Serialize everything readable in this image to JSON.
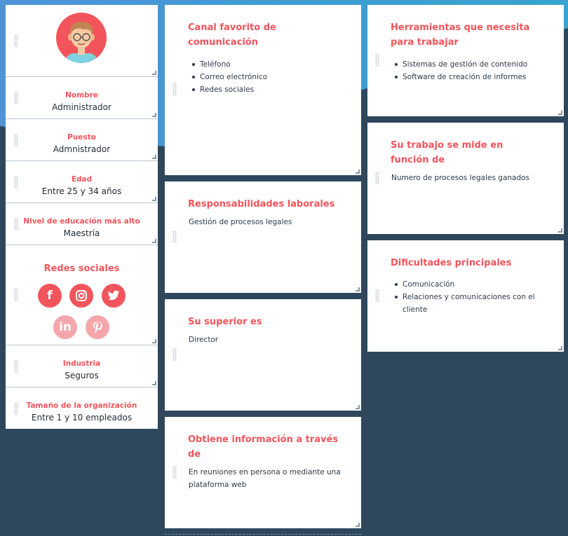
{
  "profile": {
    "avatar_icon": "user-avatar-icon",
    "nombre": {
      "label": "Nombre",
      "value": "Administrador"
    },
    "puesto": {
      "label": "Puesto",
      "value": "Admnistrador"
    },
    "edad": {
      "label": "Edad",
      "value": "Entre 25 y 34 años"
    },
    "educacion": {
      "label": "Nivel de educación más alto",
      "value": "Maestría"
    },
    "redes": {
      "title": "Redes sociales",
      "icons": [
        "facebook-icon",
        "instagram-icon",
        "twitter-icon",
        "linkedin-icon",
        "pinterest-icon"
      ]
    },
    "industria": {
      "label": "Industria",
      "value": "Seguros"
    },
    "tamano": {
      "label": "Tamaño de la organización",
      "value": "Entre 1 y 10 empleados"
    }
  },
  "cards": {
    "canal": {
      "title": "Canal favorito de comunicación",
      "items": [
        "Teléfono",
        "Correo electrónico",
        "Redes sociales"
      ]
    },
    "responsabilidades": {
      "title": "Responsabilidades laborales",
      "text": "Gestión de procesos legales"
    },
    "superior": {
      "title": "Su superior es",
      "text": "Director"
    },
    "informacion": {
      "title": "Obtiene información a través de",
      "text": "En reuniones en persona o mediante una plataforma web"
    },
    "herramientas": {
      "title": "Herramientas que necesita para trabajar",
      "items": [
        "Sistemas de gestión de contenido",
        "Software de creación de informes"
      ]
    },
    "medicion": {
      "title": "Su trabajo se mide en función de",
      "text": "Numero de procesos legales ganados"
    },
    "dificultades": {
      "title": "Dificultades principales",
      "items": [
        "Comunicación",
        "Relaciones y comunicaciones con el cliente"
      ]
    }
  },
  "colors": {
    "accent": "#f2545b",
    "background": "#2e475d",
    "gradient": "#4e94d4"
  }
}
